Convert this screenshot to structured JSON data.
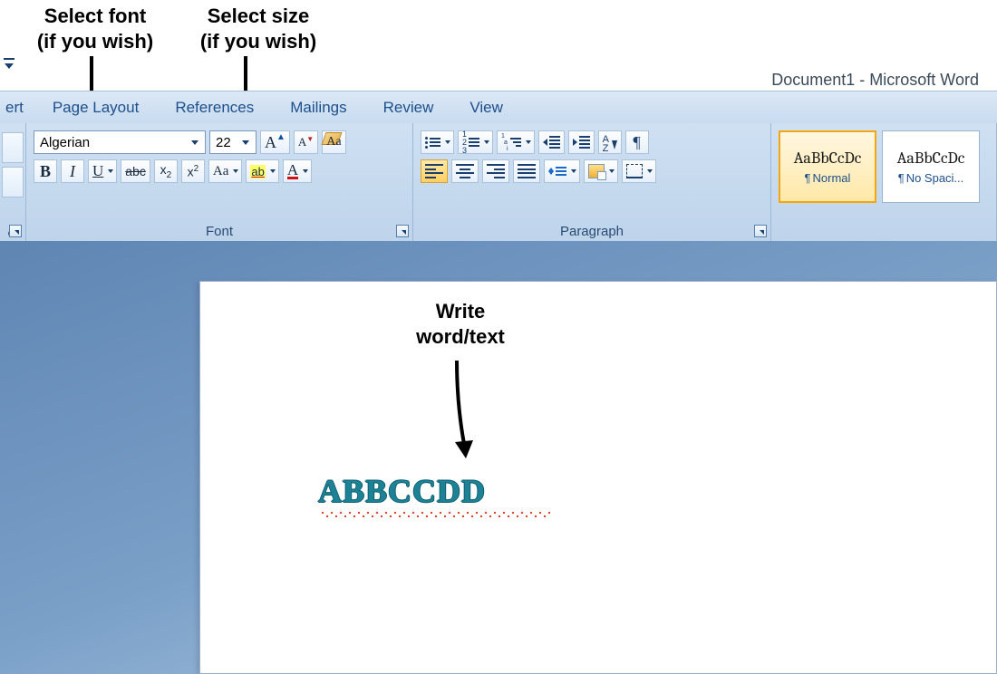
{
  "annotations": {
    "font_label": "Select font\n(if you wish)",
    "size_label": "Select size\n(if you wish)",
    "write_label": "Write\nword/text"
  },
  "window": {
    "title": "Document1 - Microsoft Word"
  },
  "tabs": {
    "t0": "ert",
    "t1": "Page Layout",
    "t2": "References",
    "t3": "Mailings",
    "t4": "Review",
    "t5": "View"
  },
  "font": {
    "name_value": "Algerian",
    "size_value": "22",
    "group_label": "Font",
    "grow": "A",
    "shrink": "A",
    "clear": "Aa",
    "bold": "B",
    "italic": "I",
    "underline": "U",
    "strike": "abc",
    "subscript": "x",
    "subscript_sub": "2",
    "superscript": "x",
    "superscript_sup": "2",
    "changecase": "Aa",
    "highlight": "ab",
    "fontcolor": "A"
  },
  "paragraph": {
    "group_label": "Paragraph",
    "sort_a": "A",
    "sort_z": "Z",
    "pilcrow": "¶"
  },
  "styles": {
    "sample": "AaBbCcDc",
    "normal": "Normal",
    "nospacing": "No Spaci...",
    "pilcrow": "¶"
  },
  "document": {
    "text": "ABBCCDD"
  }
}
